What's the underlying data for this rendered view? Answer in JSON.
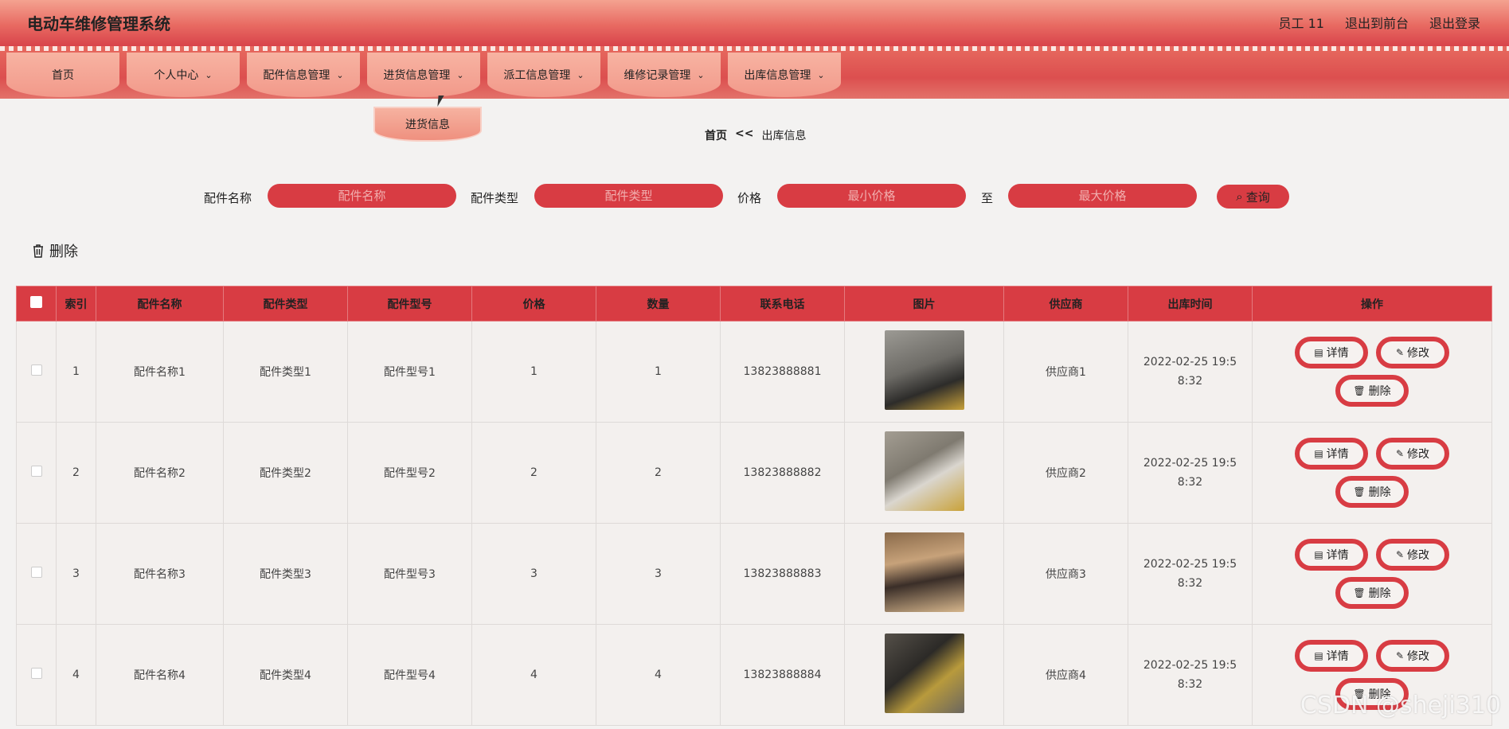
{
  "header": {
    "title": "电动车维修管理系统",
    "user": "员工 11",
    "back_front": "退出到前台",
    "logout": "退出登录"
  },
  "nav": {
    "items": [
      {
        "label": "首页",
        "has_arrow": false
      },
      {
        "label": "个人中心",
        "has_arrow": true
      },
      {
        "label": "配件信息管理",
        "has_arrow": true
      },
      {
        "label": "进货信息管理",
        "has_arrow": true
      },
      {
        "label": "派工信息管理",
        "has_arrow": true
      },
      {
        "label": "维修记录管理",
        "has_arrow": true
      },
      {
        "label": "出库信息管理",
        "has_arrow": true
      }
    ],
    "dropdown_item": "进货信息"
  },
  "breadcrumb": {
    "home": "首页",
    "sep": "<<",
    "current": "出库信息"
  },
  "search": {
    "name_label": "配件名称",
    "name_placeholder": "配件名称",
    "type_label": "配件类型",
    "type_placeholder": "配件类型",
    "price_label": "价格",
    "min_placeholder": "最小价格",
    "to_label": "至",
    "max_placeholder": "最大价格",
    "query_label": "查询"
  },
  "toolbar": {
    "delete_label": "删除"
  },
  "table": {
    "headers": [
      "索引",
      "配件名称",
      "配件类型",
      "配件型号",
      "价格",
      "数量",
      "联系电话",
      "图片",
      "供应商",
      "出库时间",
      "操作"
    ],
    "rows": [
      {
        "index": "1",
        "name": "配件名称1",
        "type": "配件类型1",
        "model": "配件型号1",
        "price": "1",
        "qty": "1",
        "phone": "13823888881",
        "supplier": "供应商1",
        "time": "2022-02-25 19:58:32"
      },
      {
        "index": "2",
        "name": "配件名称2",
        "type": "配件类型2",
        "model": "配件型号2",
        "price": "2",
        "qty": "2",
        "phone": "13823888882",
        "supplier": "供应商2",
        "time": "2022-02-25 19:58:32"
      },
      {
        "index": "3",
        "name": "配件名称3",
        "type": "配件类型3",
        "model": "配件型号3",
        "price": "3",
        "qty": "3",
        "phone": "13823888883",
        "supplier": "供应商3",
        "time": "2022-02-25 19:58:32"
      },
      {
        "index": "4",
        "name": "配件名称4",
        "type": "配件类型4",
        "model": "配件型号4",
        "price": "4",
        "qty": "4",
        "phone": "13823888884",
        "supplier": "供应商4",
        "time": "2022-02-25 19:58:32"
      }
    ],
    "ops": {
      "detail": "详情",
      "edit": "修改",
      "delete": "删除"
    }
  },
  "watermark": "CSDN @sheji310",
  "colors": {
    "accent": "#d83c43",
    "nav_pill": "#f4a896",
    "header_top": "#f4a290"
  },
  "icons": {
    "delete": "trash-icon",
    "query": "search-icon",
    "detail": "document-icon",
    "edit": "pencil-icon",
    "dropdown": "chevron-down-icon"
  }
}
